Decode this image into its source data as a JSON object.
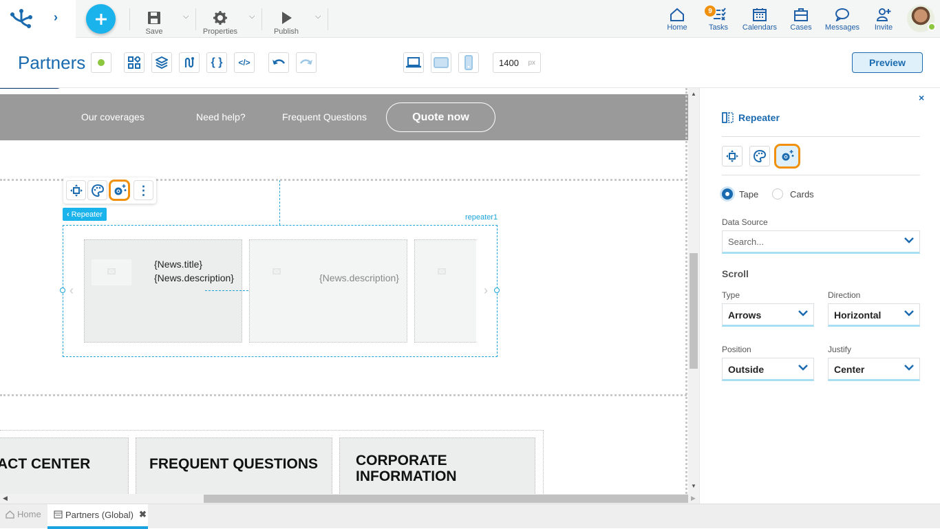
{
  "topbar": {
    "save_label": "Save",
    "properties_label": "Properties",
    "publish_label": "Publish",
    "nav": [
      {
        "label": "Home",
        "icon": "home-icon"
      },
      {
        "label": "Tasks",
        "icon": "tasks-icon",
        "badge": "9"
      },
      {
        "label": "Calendars",
        "icon": "calendar-icon"
      },
      {
        "label": "Cases",
        "icon": "briefcase-icon"
      },
      {
        "label": "Messages",
        "icon": "chat-icon"
      },
      {
        "label": "Invite",
        "icon": "invite-icon"
      }
    ],
    "accent": "#1ab3ec",
    "badge_color": "#f0900c",
    "online_color": "#8dc63f"
  },
  "pagebar": {
    "title": "Partners",
    "width_value": "1400",
    "width_unit": "px",
    "preview_label": "Preview"
  },
  "canvas": {
    "site_nav": [
      "Our coverages",
      "Need help?",
      "Frequent Questions"
    ],
    "quote_label": "Quote now",
    "repeater_tag": "Repeater",
    "repeater_id": "repeater1",
    "card1_title": "{News.title}",
    "card1_desc": "{News.description}",
    "card2_desc": "{News.description}",
    "footer_cards": [
      "ACT CENTER",
      "FREQUENT QUESTIONS",
      "CORPORATE INFORMATION"
    ]
  },
  "panel": {
    "title": "Repeater",
    "radio_tape": "Tape",
    "radio_cards": "Cards",
    "selected_mode": "Tape",
    "data_source_label": "Data Source",
    "data_source_placeholder": "Search...",
    "scroll_heading": "Scroll",
    "type_label": "Type",
    "type_value": "Arrows",
    "direction_label": "Direction",
    "direction_value": "Horizontal",
    "position_label": "Position",
    "position_value": "Outside",
    "justify_label": "Justify",
    "justify_value": "Center"
  },
  "tabs": [
    {
      "label": "Home",
      "active": false
    },
    {
      "label": "Partners (Global)",
      "active": true
    }
  ]
}
